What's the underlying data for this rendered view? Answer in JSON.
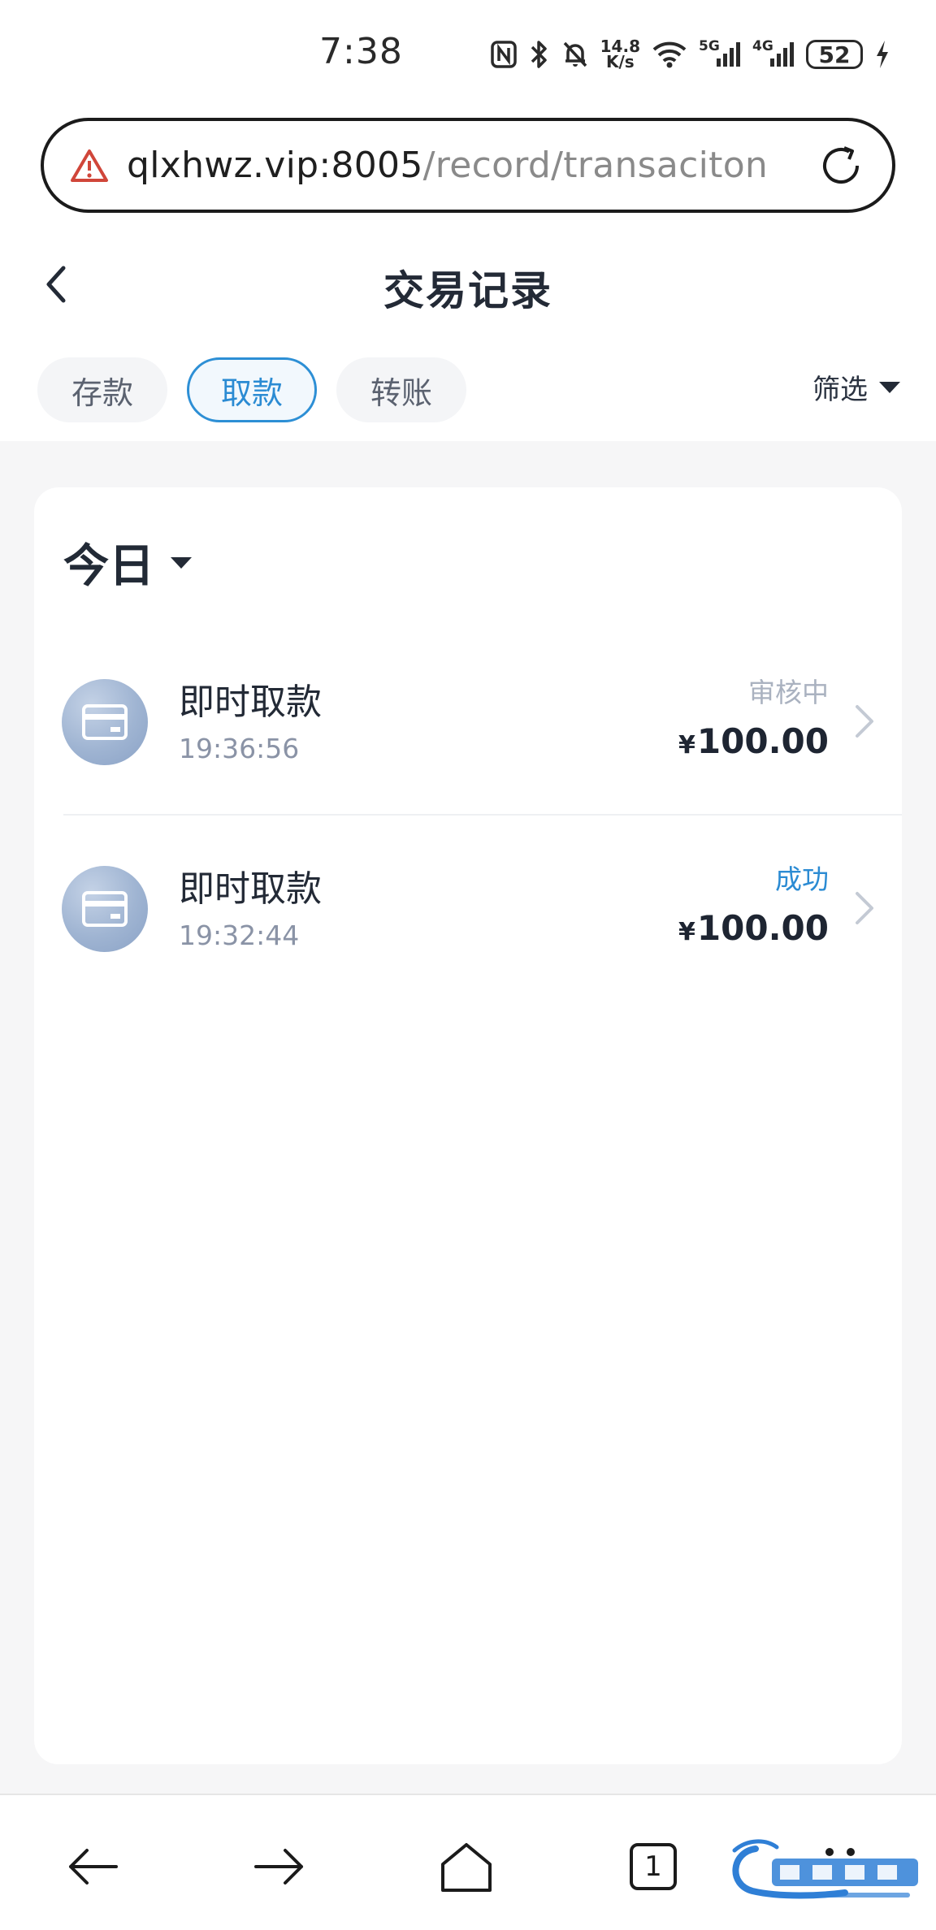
{
  "status_bar": {
    "time": "7:38",
    "net_speed_value": "14.8",
    "net_speed_unit": "K/s",
    "signal1_label": "5G",
    "signal2_label": "4G",
    "battery": "52",
    "icons": [
      "nfc-icon",
      "bluetooth-icon",
      "mute-icon",
      "wifi-icon",
      "signal-icon",
      "charging-icon"
    ]
  },
  "address_bar": {
    "host": "qlxhwz.vip:8005",
    "path": "/record/transaciton",
    "warning_icon": "warning-icon",
    "reload_icon": "reload-icon"
  },
  "header": {
    "title": "交易记录",
    "back_icon": "chevron-left-icon"
  },
  "tabs": [
    {
      "label": "存款",
      "active": false
    },
    {
      "label": "取款",
      "active": true
    },
    {
      "label": "转账",
      "active": false
    }
  ],
  "filter": {
    "label": "筛选",
    "icon": "caret-down-icon"
  },
  "date_selector": {
    "label": "今日"
  },
  "records": [
    {
      "title": "即时取款",
      "time": "19:36:56",
      "status": "审核中",
      "status_type": "pending",
      "currency": "¥",
      "amount": "100.00"
    },
    {
      "title": "即时取款",
      "time": "19:32:44",
      "status": "成功",
      "status_type": "success",
      "currency": "¥",
      "amount": "100.00"
    }
  ],
  "bottom_nav": {
    "tab_count": "1",
    "items": [
      "back-arrow-icon",
      "forward-arrow-icon",
      "home-icon",
      "tabs-icon",
      "more-icon"
    ]
  },
  "colors": {
    "accent": "#2b8bd3",
    "pending": "#aab2c0",
    "text_primary": "#232a36",
    "text_secondary": "#8a93a6",
    "warning": "#d0463a"
  }
}
